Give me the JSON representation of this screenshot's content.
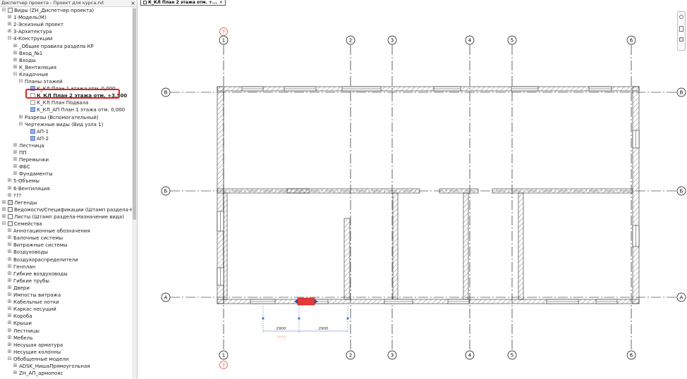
{
  "browser": {
    "title": "Диспетчер проекта - Проект для курса.rvt",
    "close_glyph": "×",
    "highlight_color": "#e02020",
    "items": [
      {
        "label": "Виды (ZH_Диспетчер проекта)",
        "indent": 0,
        "toggle": "⊟",
        "icon": "views-icon",
        "bold": false
      },
      {
        "label": "1-Модель(М)",
        "indent": 1,
        "toggle": "⊞",
        "icon": "",
        "bold": false
      },
      {
        "label": "2-Эскизный проект",
        "indent": 1,
        "toggle": "⊞",
        "icon": "",
        "bold": false
      },
      {
        "label": "3-Архитектура",
        "indent": 1,
        "toggle": "⊞",
        "icon": "",
        "bold": false
      },
      {
        "label": "4-Конструкции",
        "indent": 1,
        "toggle": "⊟",
        "icon": "",
        "bold": false
      },
      {
        "label": "_Общие правила раздела КР",
        "indent": 2,
        "toggle": "⊞",
        "icon": "",
        "bold": false
      },
      {
        "label": "Вход_№1",
        "indent": 2,
        "toggle": "⊞",
        "icon": "",
        "bold": false
      },
      {
        "label": "Входы",
        "indent": 2,
        "toggle": "⊞",
        "icon": "",
        "bold": false
      },
      {
        "label": "К_Вентиляция",
        "indent": 2,
        "toggle": "⊞",
        "icon": "",
        "bold": false
      },
      {
        "label": "Кладочные",
        "indent": 2,
        "toggle": "⊟",
        "icon": "",
        "bold": false
      },
      {
        "label": "Планы этажей",
        "indent": 3,
        "toggle": "⊟",
        "icon": "",
        "bold": false
      },
      {
        "label": "К_КЛ План 1 этажа отм. 0,000",
        "indent": 4,
        "toggle": "",
        "icon": "plan-icon",
        "bold": false
      },
      {
        "label": "К_КЛ План 2 этажа отм. +3,500",
        "indent": 4,
        "toggle": "",
        "icon": "blank-icon",
        "bold": true
      },
      {
        "label": "К_КЛ План Подвала",
        "indent": 4,
        "toggle": "",
        "icon": "blank-icon",
        "bold": false
      },
      {
        "label": "К_КЛ_АП План 1 этажа отм. 0,000",
        "indent": 4,
        "toggle": "",
        "icon": "plan-icon",
        "bold": false
      },
      {
        "label": "Разрезы (Вспомогательный)",
        "indent": 3,
        "toggle": "⊞",
        "icon": "",
        "bold": false
      },
      {
        "label": "Чертежные виды (Вид узла 1)",
        "indent": 3,
        "toggle": "⊟",
        "icon": "",
        "bold": false
      },
      {
        "label": "АП-1",
        "indent": 4,
        "toggle": "",
        "icon": "plan-icon",
        "bold": false
      },
      {
        "label": "АП-2",
        "indent": 4,
        "toggle": "",
        "icon": "plan-icon",
        "bold": false
      },
      {
        "label": "Лестница",
        "indent": 2,
        "toggle": "⊞",
        "icon": "",
        "bold": false
      },
      {
        "label": "ПП",
        "indent": 2,
        "toggle": "⊞",
        "icon": "",
        "bold": false
      },
      {
        "label": "Перемычки",
        "indent": 2,
        "toggle": "⊞",
        "icon": "",
        "bold": false
      },
      {
        "label": "ФБС",
        "indent": 2,
        "toggle": "⊞",
        "icon": "",
        "bold": false
      },
      {
        "label": "Фундаменты",
        "indent": 2,
        "toggle": "⊞",
        "icon": "",
        "bold": false
      },
      {
        "label": "5-Объемы",
        "indent": 1,
        "toggle": "⊞",
        "icon": "",
        "bold": false
      },
      {
        "label": "6-Вентиляция",
        "indent": 1,
        "toggle": "⊞",
        "icon": "",
        "bold": false
      },
      {
        "label": "???",
        "indent": 1,
        "toggle": "⊞",
        "icon": "",
        "bold": false
      },
      {
        "label": "Легенды",
        "indent": 0,
        "toggle": "⊞",
        "icon": "legend-icon",
        "bold": false
      },
      {
        "label": "Ведомости/Спецификации (Штамп раздела-Назначе",
        "indent": 0,
        "toggle": "⊞",
        "icon": "schedule-icon",
        "bold": false
      },
      {
        "label": "Листы (Штамп раздела-Назначение вида)",
        "indent": 0,
        "toggle": "⊞",
        "icon": "sheet-icon",
        "bold": false
      },
      {
        "label": "Семейства",
        "indent": 0,
        "toggle": "⊟",
        "icon": "family-icon",
        "bold": false
      },
      {
        "label": "Аннотационные обозначения",
        "indent": 1,
        "toggle": "⊞",
        "icon": "",
        "bold": false
      },
      {
        "label": "Балочные системы",
        "indent": 1,
        "toggle": "⊞",
        "icon": "",
        "bold": false
      },
      {
        "label": "Витражные системы",
        "indent": 1,
        "toggle": "⊞",
        "icon": "",
        "bold": false
      },
      {
        "label": "Воздуховоды",
        "indent": 1,
        "toggle": "⊞",
        "icon": "",
        "bold": false
      },
      {
        "label": "Воздухораспределители",
        "indent": 1,
        "toggle": "⊞",
        "icon": "",
        "bold": false
      },
      {
        "label": "Генплан",
        "indent": 1,
        "toggle": "⊞",
        "icon": "",
        "bold": false
      },
      {
        "label": "Гибкие воздуховоды",
        "indent": 1,
        "toggle": "⊞",
        "icon": "",
        "bold": false
      },
      {
        "label": "Гибкие трубы",
        "indent": 1,
        "toggle": "⊞",
        "icon": "",
        "bold": false
      },
      {
        "label": "Двери",
        "indent": 1,
        "toggle": "⊞",
        "icon": "",
        "bold": false
      },
      {
        "label": "Импосты витража",
        "indent": 1,
        "toggle": "⊞",
        "icon": "",
        "bold": false
      },
      {
        "label": "Кабельные лотки",
        "indent": 1,
        "toggle": "⊞",
        "icon": "",
        "bold": false
      },
      {
        "label": "Каркас несущий",
        "indent": 1,
        "toggle": "⊞",
        "icon": "",
        "bold": false
      },
      {
        "label": "Короба",
        "indent": 1,
        "toggle": "⊞",
        "icon": "",
        "bold": false
      },
      {
        "label": "Крыши",
        "indent": 1,
        "toggle": "⊞",
        "icon": "",
        "bold": false
      },
      {
        "label": "Лестницы",
        "indent": 1,
        "toggle": "⊞",
        "icon": "",
        "bold": false
      },
      {
        "label": "Мебель",
        "indent": 1,
        "toggle": "⊞",
        "icon": "",
        "bold": false
      },
      {
        "label": "Несущая арматура",
        "indent": 1,
        "toggle": "⊞",
        "icon": "",
        "bold": false
      },
      {
        "label": "Несущие колонны",
        "indent": 1,
        "toggle": "⊞",
        "icon": "",
        "bold": false
      },
      {
        "label": "Обобщенные модели",
        "indent": 1,
        "toggle": "⊟",
        "icon": "",
        "bold": false
      },
      {
        "label": "ADSK_НишаПрямоугольная",
        "indent": 2,
        "toggle": "⊞",
        "icon": "",
        "bold": false
      },
      {
        "label": "ZH_АП_армопояс",
        "indent": 2,
        "toggle": "⊞",
        "icon": "",
        "bold": false
      }
    ]
  },
  "view": {
    "tab_label": "К_КЛ План 2 этажа отм. +...",
    "tab_close": "×",
    "grid_columns": [
      "1",
      "2",
      "3",
      "4",
      "5",
      "6"
    ],
    "grid_rows": [
      "В",
      "Б",
      "А"
    ],
    "section_marker": "7",
    "dimensions": [
      "2900",
      "2900"
    ],
    "dimension_note": "(^^)",
    "colors": {
      "grid_bubble_marker": "#e0553a",
      "dimension": "#4a72c8",
      "selected_element": "#e53935",
      "hatch": "#555555"
    }
  }
}
